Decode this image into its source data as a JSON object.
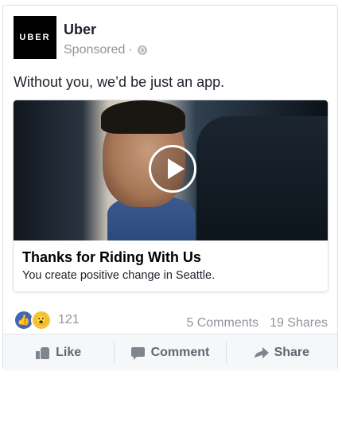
{
  "advertiser": {
    "logo_text": "UBER",
    "name": "Uber",
    "sponsored_label": "Sponsored",
    "separator": "·",
    "privacy_icon": "globe-icon"
  },
  "post": {
    "text": "Without you, we’d be just an app."
  },
  "media": {
    "play_icon": "play-icon",
    "caption_title": "Thanks for Riding With Us",
    "caption_subtitle": "You create positive change in Seattle."
  },
  "engagement": {
    "reaction_icons": [
      "like-reaction-icon",
      "wow-reaction-icon"
    ],
    "reaction_count": "121",
    "comments": "5 Comments",
    "shares": "19 Shares"
  },
  "actions": [
    {
      "label": "Like",
      "icon": "thumbs-up-icon"
    },
    {
      "label": "Comment",
      "icon": "comment-icon"
    },
    {
      "label": "Share",
      "icon": "share-icon"
    }
  ],
  "colors": {
    "like_blue": "#4267b2",
    "wow_yellow": "#f5c33b",
    "muted_text": "#90949c",
    "action_text": "#606770"
  }
}
